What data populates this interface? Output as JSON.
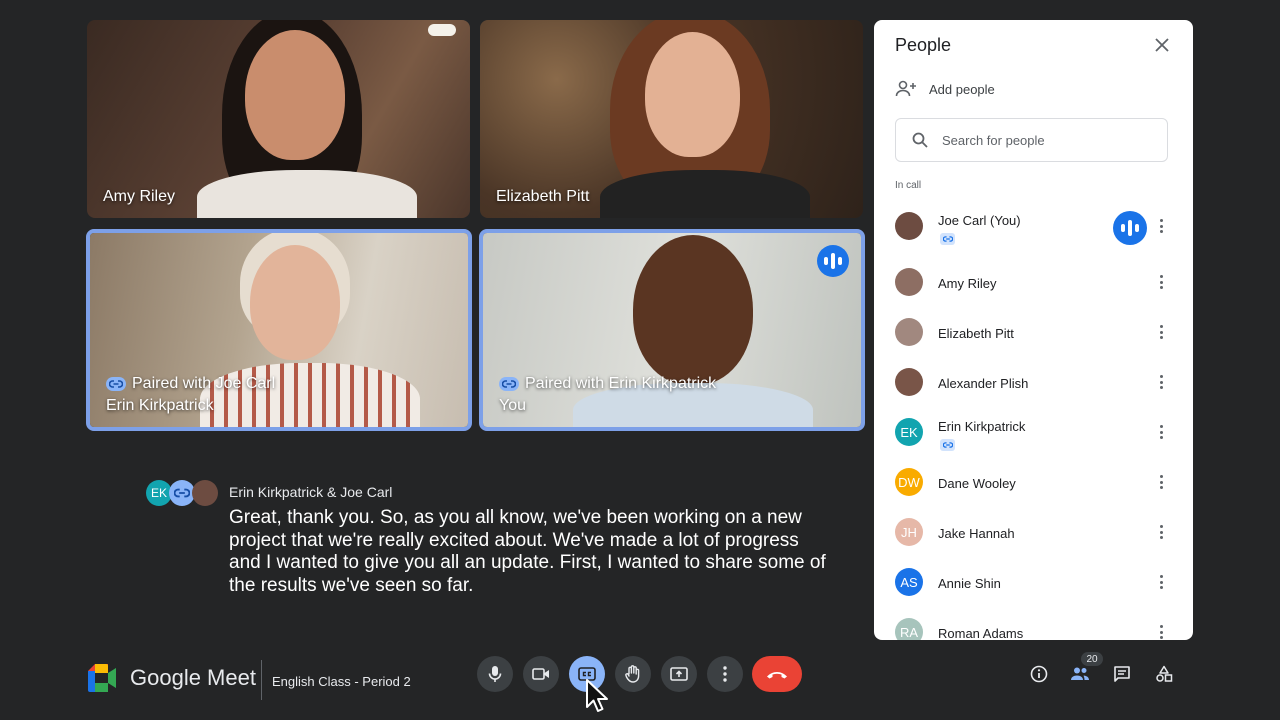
{
  "tiles": [
    {
      "name": "Amy Riley",
      "paired_text": null
    },
    {
      "name": "Elizabeth Pitt",
      "paired_text": null
    },
    {
      "name": "Erin Kirkpatrick",
      "paired_text": "Paired with Joe Carl"
    },
    {
      "name": "You",
      "paired_text": "Paired with Erin Kirkpatrick"
    }
  ],
  "caption": {
    "avatar_initials": "EK",
    "speaker": "Erin Kirkpatrick & Joe Carl",
    "text": "Great, thank you. So, as you all know, we've been working on a new project that we're really excited about. We've made a lot of progress and I wanted to give you all an update. First, I wanted to share some of the results we've seen so far."
  },
  "panel": {
    "title": "People",
    "add_people": "Add people",
    "search_placeholder": "Search for people",
    "section_label": "In call",
    "people": [
      {
        "name": "Joe Carl (You)",
        "initials": "",
        "color": "#6d4c41",
        "paired": true,
        "speaking": true
      },
      {
        "name": "Amy Riley",
        "initials": "",
        "color": "#8d6e63",
        "paired": false,
        "speaking": false
      },
      {
        "name": "Elizabeth Pitt",
        "initials": "",
        "color": "#a1887f",
        "paired": false,
        "speaking": false
      },
      {
        "name": "Alexander Plish",
        "initials": "",
        "color": "#795548",
        "paired": false,
        "speaking": false
      },
      {
        "name": "Erin Kirkpatrick",
        "initials": "EK",
        "color": "#12a4af",
        "paired": true,
        "speaking": false
      },
      {
        "name": "Dane Wooley",
        "initials": "DW",
        "color": "#f9ab00",
        "paired": false,
        "speaking": false
      },
      {
        "name": "Jake Hannah",
        "initials": "JH",
        "color": "#e6b8a8",
        "paired": false,
        "speaking": false
      },
      {
        "name": "Annie Shin",
        "initials": "AS",
        "color": "#1a73e8",
        "paired": false,
        "speaking": false
      },
      {
        "name": "Roman Adams",
        "initials": "RA",
        "color": "#a7c4bc",
        "paired": false,
        "speaking": false
      }
    ]
  },
  "bottom_bar": {
    "brand": "Google Meet",
    "meeting_title": "English Class - Period 2",
    "participant_count": "20"
  },
  "colors": {
    "background": "#242526",
    "accent": "#1a73e8",
    "paired_border": "#7da0e8",
    "end_call": "#ea4335"
  }
}
